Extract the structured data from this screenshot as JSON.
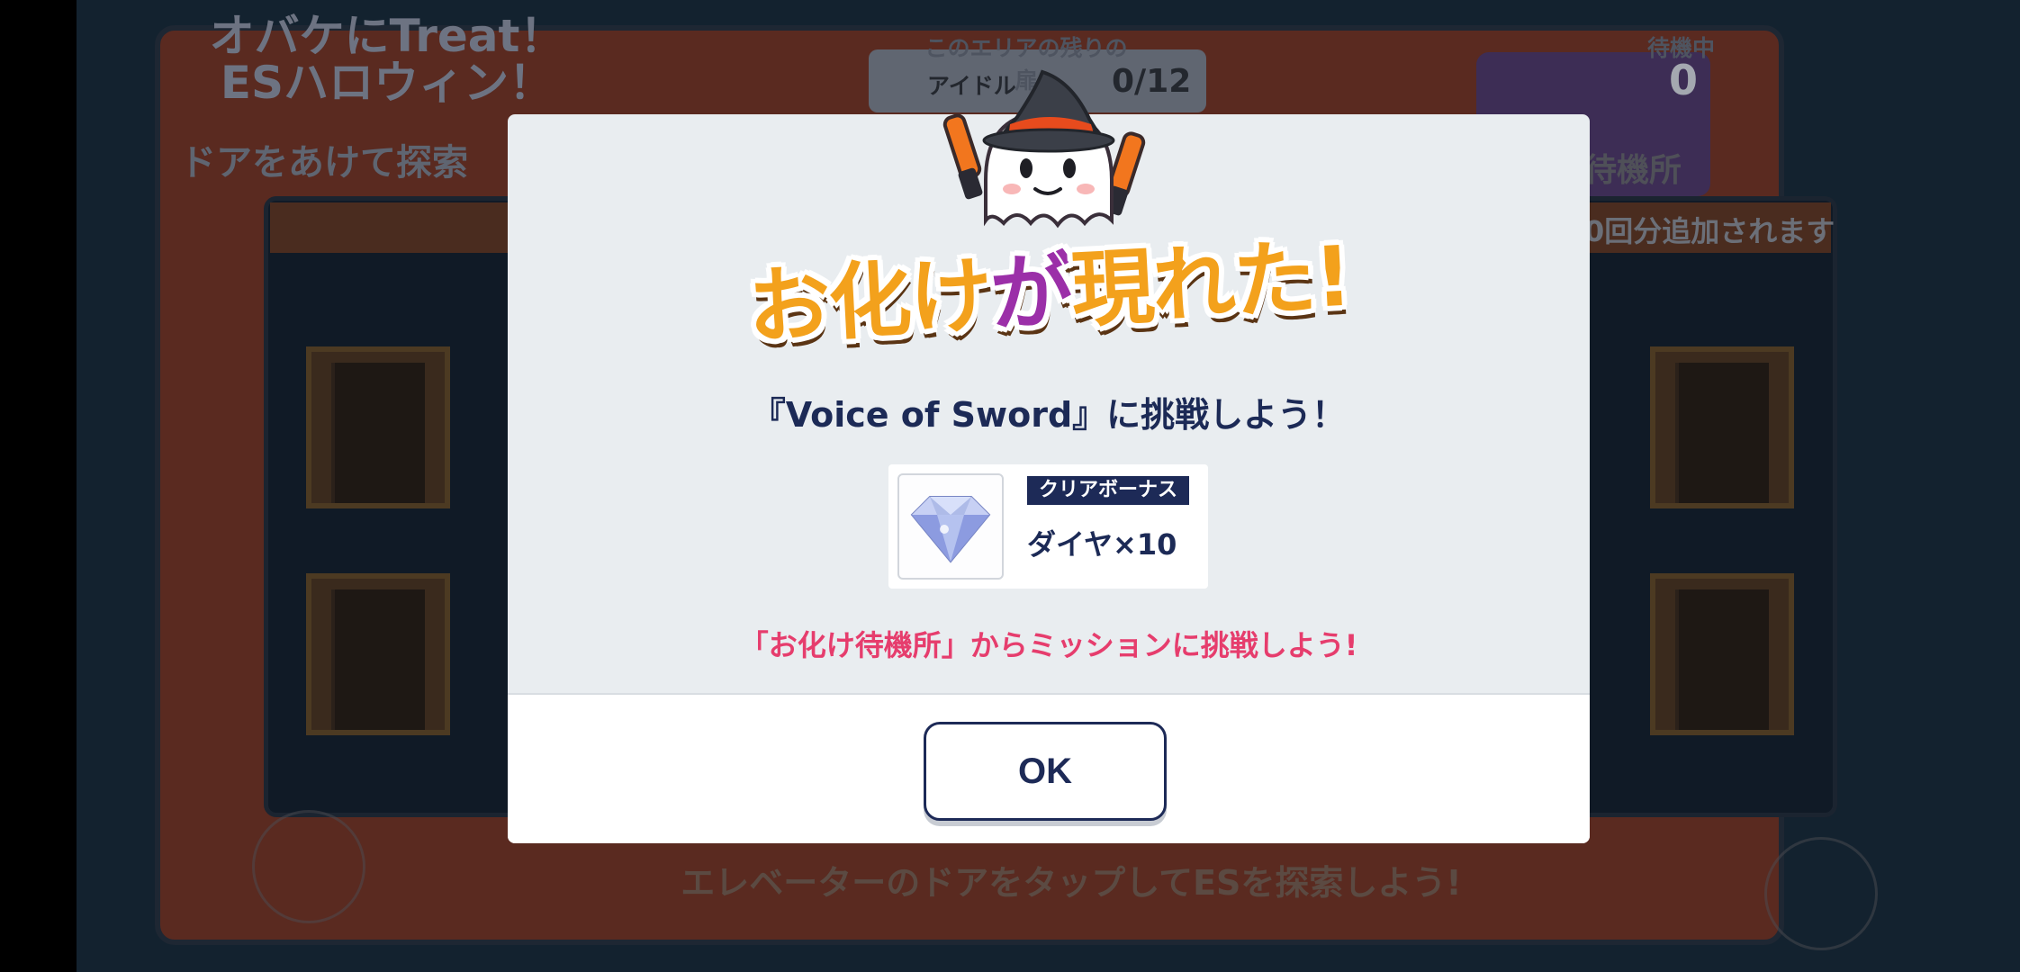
{
  "background": {
    "title": "オバケにTreat！\nESハロウィン！",
    "subtitle": "ドアをあけて探索",
    "remaining": {
      "caption": "このエリアの残りの扉",
      "label": "アイドル",
      "count": "0/12"
    },
    "standby": {
      "caption": "待機中",
      "count": "0",
      "label": "待機所"
    },
    "band_text": "0回分追加されます",
    "hint": "エレベーターのドアをタップしてESを探索しよう!"
  },
  "dialog": {
    "heading_part1": "お化け",
    "heading_part2": "が",
    "heading_part3": "現れた!",
    "challenge_text": "『Voice of Sword』に挑戦しよう！",
    "reward": {
      "tag": "クリアボーナス",
      "value": "ダイヤ×10",
      "icon": "diamond-icon"
    },
    "note": "「お化け待機所」からミッションに挑戦しよう!",
    "ok_label": "OK"
  },
  "colors": {
    "accent_navy": "#1d2a57",
    "note_pink": "#e63d6d",
    "heading_orange": "#f3a11c",
    "heading_purple": "#9b2fa8"
  }
}
